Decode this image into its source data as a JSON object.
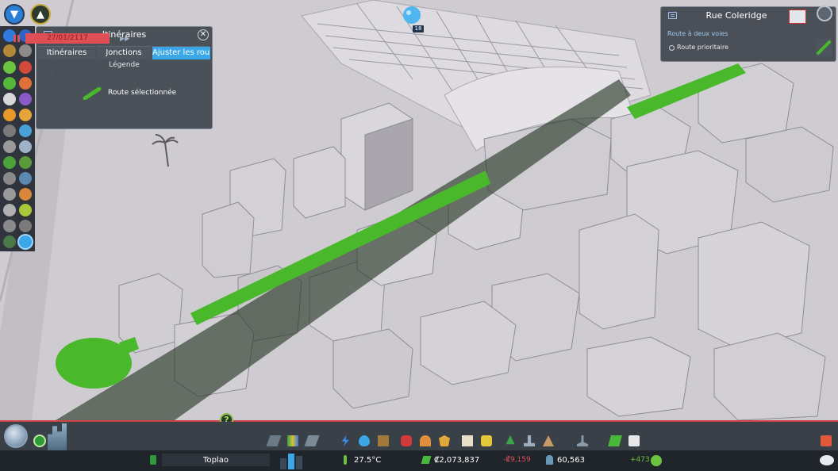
{
  "routes_panel": {
    "title": "Itinéraires",
    "tabs": [
      {
        "label": "Itinéraires",
        "active": false
      },
      {
        "label": "Jonctions",
        "active": false
      },
      {
        "label": "Ajuster les routes",
        "active": true
      }
    ],
    "legend_title": "Légende",
    "legend_item": "Route sélectionnée",
    "close_icon": "close-icon"
  },
  "info_panel": {
    "title": "Rue Coleridge",
    "road_type": "Route à deux voies",
    "priority_label": "Route prioritaire"
  },
  "marker": {
    "count": "18"
  },
  "help": {
    "label": "?"
  },
  "status_bar": {
    "date": "27/01/2117",
    "city_name": "Toplao",
    "temperature": "27.5°C",
    "money": "₡2,073,837",
    "money_delta": "-₡9,159",
    "population": "60,563",
    "population_delta": "+473"
  },
  "colors": {
    "route_green": "#49b82a",
    "accent_blue": "#3aa7e8",
    "date_red": "#e04f56"
  }
}
